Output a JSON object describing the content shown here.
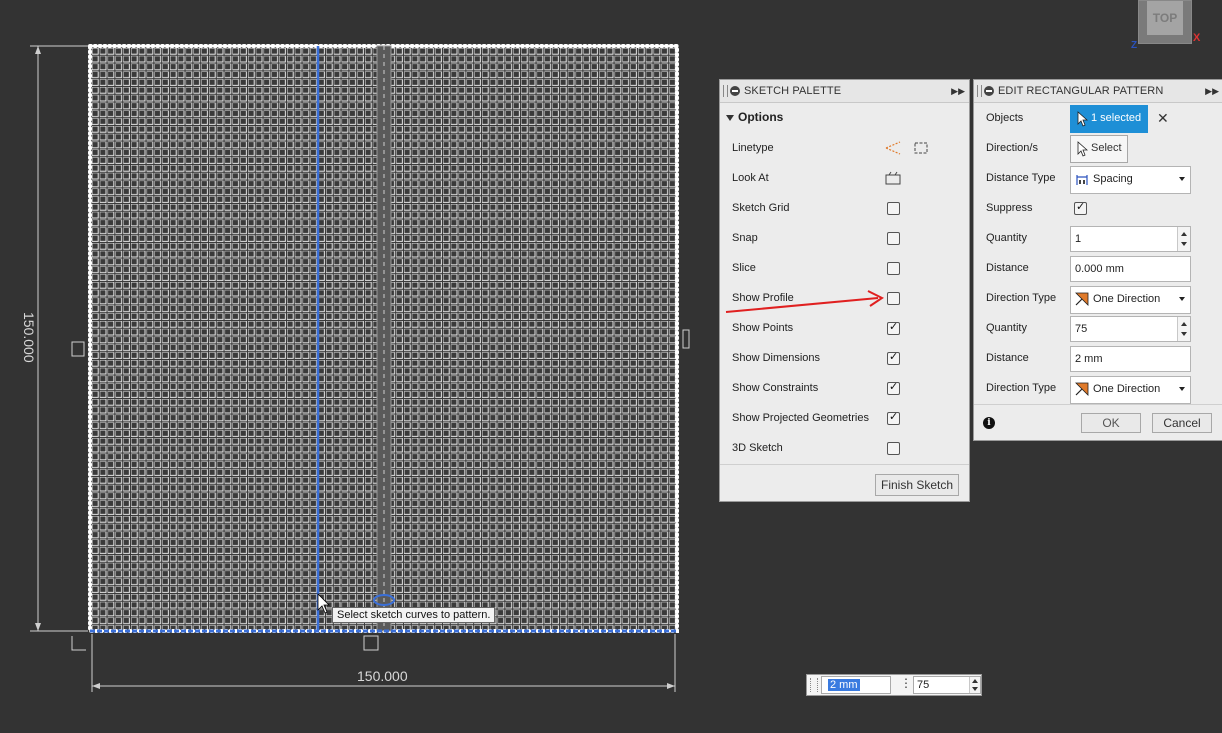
{
  "canvas": {
    "tooltip": "Select sketch curves to pattern.",
    "dim_vertical": "150.000",
    "dim_horizontal": "150.000"
  },
  "viewcube": {
    "face_label": "TOP",
    "axis_x": "X",
    "axis_z": "Z"
  },
  "sketch_palette": {
    "title": "SKETCH PALETTE",
    "section": "Options",
    "rows": [
      {
        "label": "Linetype",
        "control": "icons"
      },
      {
        "label": "Look At",
        "control": "icon"
      },
      {
        "label": "Sketch Grid",
        "checked": false
      },
      {
        "label": "Snap",
        "checked": false
      },
      {
        "label": "Slice",
        "checked": false
      },
      {
        "label": "Show Profile",
        "checked": false
      },
      {
        "label": "Show Points",
        "checked": true
      },
      {
        "label": "Show Dimensions",
        "checked": true
      },
      {
        "label": "Show Constraints",
        "checked": true
      },
      {
        "label": "Show Projected Geometries",
        "checked": true
      },
      {
        "label": "3D Sketch",
        "checked": false
      }
    ],
    "finish_button": "Finish Sketch"
  },
  "edit_pattern": {
    "title": "EDIT RECTANGULAR PATTERN",
    "objects_label": "Objects",
    "objects_value": "1 selected",
    "directions_label": "Direction/s",
    "directions_value": "Select",
    "distance_type_label": "Distance Type",
    "distance_type_value": "Spacing",
    "suppress_label": "Suppress",
    "suppress_checked": true,
    "quantity1_label": "Quantity",
    "quantity1_value": "1",
    "distance1_label": "Distance",
    "distance1_value": "0.000 mm",
    "direction_type1_label": "Direction Type",
    "direction_type1_value": "One Direction",
    "quantity2_label": "Quantity",
    "quantity2_value": "75",
    "distance2_label": "Distance",
    "distance2_value": "2 mm",
    "direction_type2_label": "Direction Type",
    "direction_type2_value": "One Direction",
    "ok_button": "OK",
    "cancel_button": "Cancel",
    "selected_color": "#1e8fd6"
  },
  "inline_input": {
    "distance_value": "2 mm",
    "quantity_value": "75"
  },
  "annotation": {
    "arrow_color": "#e02020"
  }
}
